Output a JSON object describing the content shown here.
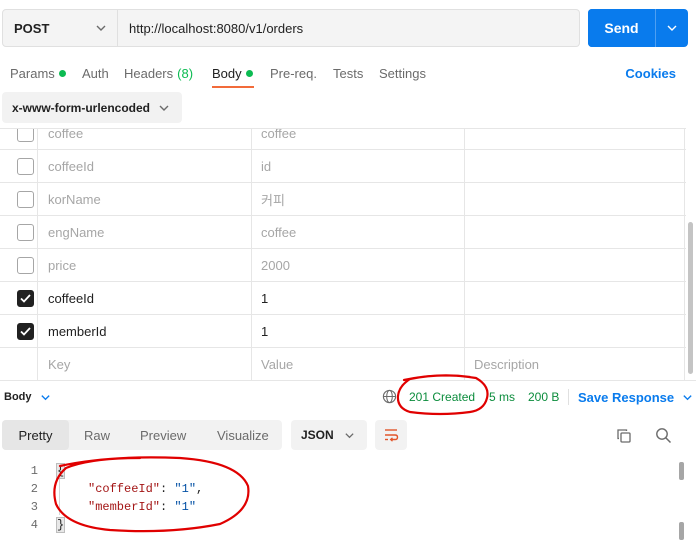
{
  "request": {
    "method": "POST",
    "url": "http://localhost:8080/v1/orders",
    "send_label": "Send"
  },
  "tabs": [
    {
      "label": "Params",
      "dot": true
    },
    {
      "label": "Auth"
    },
    {
      "label": "Headers",
      "count": "(8)"
    },
    {
      "label": "Body",
      "dot": true,
      "active": true
    },
    {
      "label": "Pre-req."
    },
    {
      "label": "Tests"
    },
    {
      "label": "Settings"
    }
  ],
  "cookies_label": "Cookies",
  "body_type": "x-www-form-urlencoded",
  "params": {
    "rows": [
      {
        "checked": false,
        "key": "coffee",
        "value": "coffee"
      },
      {
        "checked": false,
        "key": "coffeeId",
        "value": "id"
      },
      {
        "checked": false,
        "key": "korName",
        "value": "커피"
      },
      {
        "checked": false,
        "key": "engName",
        "value": "coffee"
      },
      {
        "checked": false,
        "key": "price",
        "value": "2000"
      },
      {
        "checked": true,
        "key": "coffeeId",
        "value": "1"
      },
      {
        "checked": true,
        "key": "memberId",
        "value": "1"
      }
    ],
    "placeholder": {
      "key": "Key",
      "value": "Value",
      "description": "Description"
    }
  },
  "response": {
    "body_label": "Body",
    "status": "201 Created",
    "time": "5 ms",
    "size": "200 B",
    "save_label": "Save Response",
    "view_tabs": [
      "Pretty",
      "Raw",
      "Preview",
      "Visualize"
    ],
    "format": "JSON",
    "lines": [
      {
        "num": "1",
        "text": "{"
      },
      {
        "num": "2",
        "key": "\"coffeeId\"",
        "colon": ": ",
        "value": "\"1\"",
        "comma": ","
      },
      {
        "num": "3",
        "key": "\"memberId\"",
        "colon": ": ",
        "value": "\"1\"",
        "comma": ""
      },
      {
        "num": "4",
        "text": "}"
      }
    ]
  },
  "colors": {
    "accent": "#097bed",
    "success": "#0cbb52",
    "status_text": "#0b8c3c",
    "active_tab_underline": "#f26b3a",
    "annotation": "#e00000"
  }
}
